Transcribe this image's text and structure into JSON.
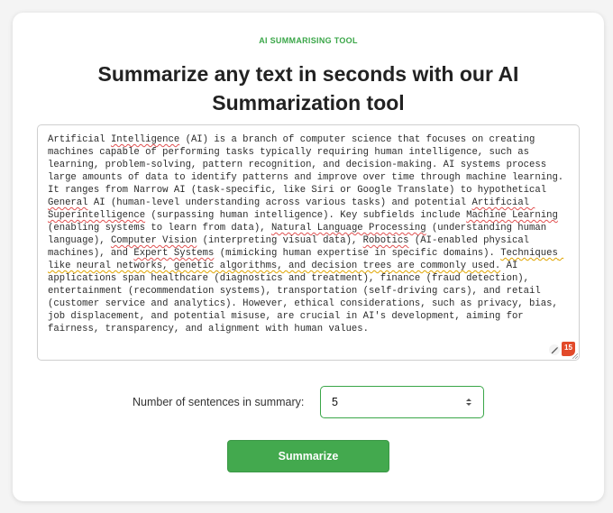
{
  "header": {
    "eyebrow": "AI SUMMARISING TOOL",
    "title": "Summarize any text in seconds with our AI Summarization tool"
  },
  "input_text": {
    "segments": [
      {
        "t": "Artificial "
      },
      {
        "t": "Intelligence",
        "mark": "spell"
      },
      {
        "t": " (AI) is a branch of computer science that focuses on creating machines capable of performing tasks typically requiring human intelligence, such as learning, problem-solving, pattern recognition, and decision-making. AI systems process large amounts of data to identify patterns and improve over time through machine learning. It ranges from Narrow AI (task-specific, like Siri or Google Translate) to hypothetical "
      },
      {
        "t": "General",
        "mark": "spell"
      },
      {
        "t": " AI (human-level understanding across various tasks) and potential "
      },
      {
        "t": "Artificial Superintelligence",
        "mark": "spell"
      },
      {
        "t": " (surpassing human intelligence). Key subfields include "
      },
      {
        "t": "Machine Learning",
        "mark": "spell"
      },
      {
        "t": " (enabling systems to learn from data), "
      },
      {
        "t": "Natural Language Processing",
        "mark": "spell"
      },
      {
        "t": " (understanding human language), "
      },
      {
        "t": "Computer Vision",
        "mark": "spell"
      },
      {
        "t": " (interpreting visual data), "
      },
      {
        "t": "Robotics",
        "mark": "spell"
      },
      {
        "t": " (AI-enabled physical machines), and "
      },
      {
        "t": "Expert Systems",
        "mark": "spell"
      },
      {
        "t": " (mimicking human expertise in specific domains). "
      },
      {
        "t": "Techniques like neural networks, genetic algorithms, and decision trees are commonly used.",
        "mark": "grammar"
      },
      {
        "t": " AI applications span healthcare (diagnostics and treatment), finance (fraud detection), entertainment (recommendation systems), transportation (self-driving cars), and retail (customer service and analytics). However, ethical considerations, such as privacy, bias, job displacement, and potential misuse, are crucial in AI's development, aiming for fairness, transparency, and alignment with human values."
      }
    ],
    "editor_badge_count": "15",
    "edit_icon": "pencil-icon"
  },
  "sentence_count": {
    "label": "Number of sentences in summary:",
    "value": "5"
  },
  "actions": {
    "summarize_label": "Summarize"
  },
  "colors": {
    "accent": "#3aa648",
    "button": "#43a94e",
    "badge": "#e24a2a",
    "spell_underline": "#e05050",
    "grammar_underline": "#e0a400"
  }
}
